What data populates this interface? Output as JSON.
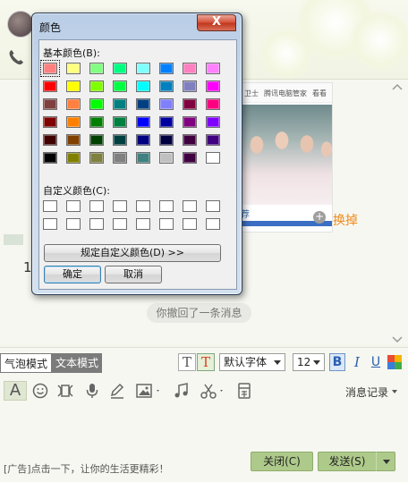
{
  "chat_window": {
    "ad_strip_items": [
      "卫士",
      "腾讯电脑管家",
      "看看"
    ],
    "ad_caption": "荐",
    "swap_label": "换掉",
    "digit_partial": "1",
    "recall_notice": "你撤回了一条消息",
    "modes": {
      "bubble": "气泡模式",
      "text": "文本模式"
    },
    "font_name": "默认字体",
    "font_size": "12",
    "format": {
      "t_plain": "T",
      "t_color": "T",
      "bold": "B",
      "italic": "I",
      "underline": "U"
    },
    "tool_A": "A",
    "history_label": "消息记录",
    "ad_link": "[广告]点击一下，让你的生活更精彩！",
    "close_button": "关闭(C)",
    "send_button": "发送(S)"
  },
  "color_dialog": {
    "title": "颜色",
    "close_symbol": "X",
    "basic_label": "基本颜色(B):",
    "custom_label": "自定义颜色(C):",
    "define_button": "规定自定义颜色(D) >>",
    "ok_button": "确定",
    "cancel_button": "取消",
    "basic_colors": [
      "#ff8080",
      "#ffff80",
      "#80ff80",
      "#00ff80",
      "#80ffff",
      "#0080ff",
      "#ff80c0",
      "#ff80ff",
      "#ff0000",
      "#ffff00",
      "#80ff00",
      "#00ff40",
      "#00ffff",
      "#0080c0",
      "#8080c0",
      "#ff00ff",
      "#804040",
      "#ff8040",
      "#00ff00",
      "#008080",
      "#004080",
      "#8080ff",
      "#800040",
      "#ff0080",
      "#800000",
      "#ff8000",
      "#008000",
      "#008040",
      "#0000ff",
      "#0000a0",
      "#800080",
      "#8000ff",
      "#400000",
      "#804000",
      "#004000",
      "#004040",
      "#000080",
      "#000040",
      "#400040",
      "#400080",
      "#000000",
      "#808000",
      "#808040",
      "#808080",
      "#408080",
      "#c0c0c0",
      "#400040",
      "#ffffff"
    ],
    "selected_index": 0,
    "custom_colors": [
      "#ffffff",
      "#ffffff",
      "#ffffff",
      "#ffffff",
      "#ffffff",
      "#ffffff",
      "#ffffff",
      "#ffffff",
      "#ffffff",
      "#ffffff",
      "#ffffff",
      "#ffffff",
      "#ffffff",
      "#ffffff",
      "#ffffff",
      "#ffffff"
    ]
  }
}
